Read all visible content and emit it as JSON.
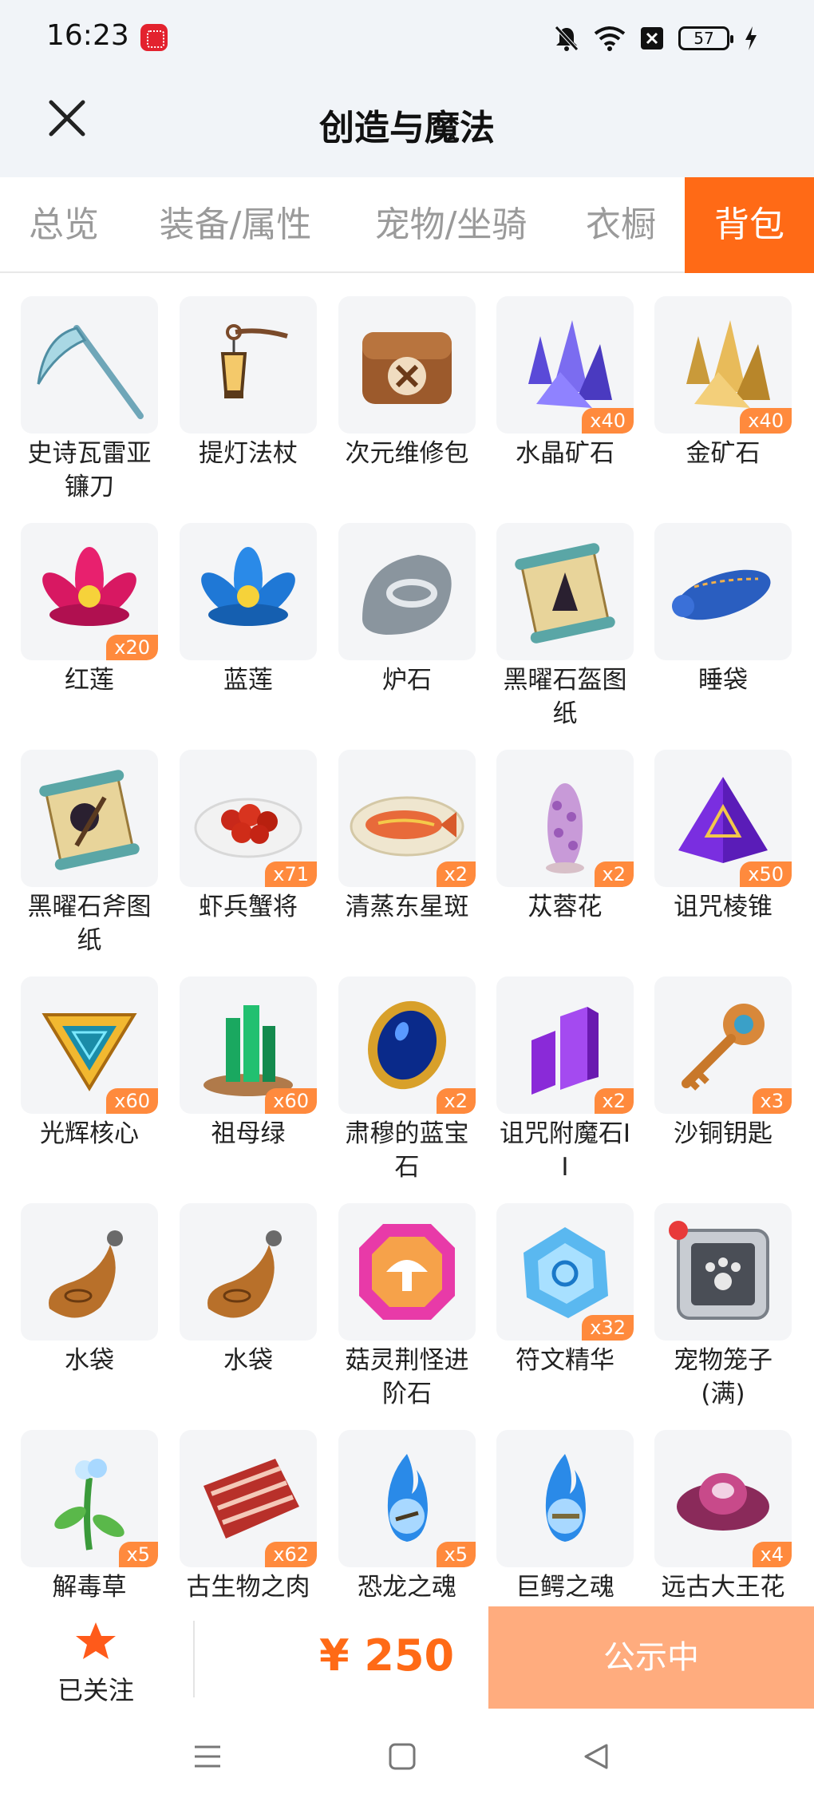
{
  "status_bar": {
    "time": "16:23",
    "battery": "57"
  },
  "header": {
    "title": "创造与魔法"
  },
  "tabs": [
    {
      "label": "总览"
    },
    {
      "label": "装备/属性"
    },
    {
      "label": "宠物/坐骑"
    },
    {
      "label": "衣橱"
    },
    {
      "label": "背包"
    }
  ],
  "items": [
    {
      "name": "史诗瓦雷亚镰刀",
      "qty": "",
      "icon": "scythe-icon"
    },
    {
      "name": "提灯法杖",
      "qty": "",
      "icon": "lantern-staff-icon"
    },
    {
      "name": "次元维修包",
      "qty": "",
      "icon": "repair-bag-icon"
    },
    {
      "name": "水晶矿石",
      "qty": "x40",
      "icon": "crystal-ore-icon"
    },
    {
      "name": "金矿石",
      "qty": "x40",
      "icon": "gold-ore-icon"
    },
    {
      "name": "红莲",
      "qty": "x20",
      "icon": "red-lotus-icon"
    },
    {
      "name": "蓝莲",
      "qty": "",
      "icon": "blue-lotus-icon"
    },
    {
      "name": "炉石",
      "qty": "",
      "icon": "hearthstone-icon"
    },
    {
      "name": "黑曜石盔图纸",
      "qty": "",
      "icon": "blueprint-scroll-icon"
    },
    {
      "name": "睡袋",
      "qty": "",
      "icon": "sleeping-bag-icon"
    },
    {
      "name": "黑曜石斧图纸",
      "qty": "",
      "icon": "blueprint-scroll-icon"
    },
    {
      "name": "虾兵蟹将",
      "qty": "x71",
      "icon": "crayfish-dish-icon"
    },
    {
      "name": "清蒸东星斑",
      "qty": "x2",
      "icon": "steamed-fish-icon"
    },
    {
      "name": "苁蓉花",
      "qty": "x2",
      "icon": "cistanche-flower-icon"
    },
    {
      "name": "诅咒棱锥",
      "qty": "x50",
      "icon": "cursed-pyramid-icon"
    },
    {
      "name": "光辉核心",
      "qty": "x60",
      "icon": "radiant-core-icon"
    },
    {
      "name": "祖母绿",
      "qty": "x60",
      "icon": "emerald-icon"
    },
    {
      "name": "肃穆的蓝宝石",
      "qty": "x2",
      "icon": "sapphire-icon"
    },
    {
      "name": "诅咒附魔石II",
      "qty": "x2",
      "icon": "enchant-stone-icon"
    },
    {
      "name": "沙铜钥匙",
      "qty": "x3",
      "icon": "key-icon"
    },
    {
      "name": "水袋",
      "qty": "",
      "icon": "water-bag-icon"
    },
    {
      "name": "水袋",
      "qty": "",
      "icon": "water-bag-icon"
    },
    {
      "name": "菇灵荆怪进阶石",
      "qty": "",
      "icon": "mushroom-stone-icon"
    },
    {
      "name": "符文精华",
      "qty": "x32",
      "icon": "rune-essence-icon"
    },
    {
      "name": "宠物笼子(满)",
      "qty": "",
      "icon": "pet-cage-icon"
    },
    {
      "name": "解毒草",
      "qty": "x5",
      "icon": "antidote-herb-icon"
    },
    {
      "name": "古生物之肉",
      "qty": "x62",
      "icon": "meat-icon"
    },
    {
      "name": "恐龙之魂",
      "qty": "x5",
      "icon": "dinosaur-soul-icon"
    },
    {
      "name": "巨鳄之魂",
      "qty": "",
      "icon": "crocodile-soul-icon"
    },
    {
      "name": "远古大王花",
      "qty": "x4",
      "icon": "rafflesia-icon"
    }
  ],
  "bottom_bar": {
    "follow_label": "已关注",
    "price": "¥ 250",
    "status_button": "公示中"
  },
  "colors": {
    "accent": "#ff6a16",
    "button_disabled": "#ffac7e",
    "qty_badge": "#ff8a3d"
  }
}
